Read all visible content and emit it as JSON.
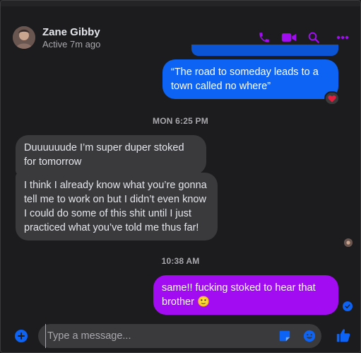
{
  "header": {
    "contact_name": "Zane Gibby",
    "status": "Active 7m ago",
    "icons": [
      "phone-icon",
      "video-camera-icon",
      "search-icon",
      "more-icon"
    ]
  },
  "colors": {
    "accent": "#a20cf3",
    "outgoing_blue": "#0d63f3",
    "outgoing_purple": "#a20cf3",
    "incoming": "#3a3a3c",
    "background": "#1c1c1e",
    "heart": "#e41e3f"
  },
  "messages": [
    {
      "text": "“The road to someday leads to a town called no where”",
      "direction": "outgoing",
      "reaction": "heart"
    },
    {
      "text": "Duuuuuude I’m super duper stoked for tomorrow",
      "direction": "incoming"
    },
    {
      "text": "I think I already know what you’re gonna tell me to work on but I didn’t even know I could do some of this shit until I just practiced what you’ve told me thus far!",
      "direction": "incoming"
    },
    {
      "text": "same!! fucking stoked to hear that brother 🙂",
      "direction": "outgoing"
    }
  ],
  "timestamps": [
    "MON 6:25 PM",
    "10:38 AM"
  ],
  "composer": {
    "placeholder": "Type a message...",
    "icons": [
      "plus-icon",
      "sticker-icon",
      "emoji-icon",
      "thumbs-up-icon"
    ]
  }
}
